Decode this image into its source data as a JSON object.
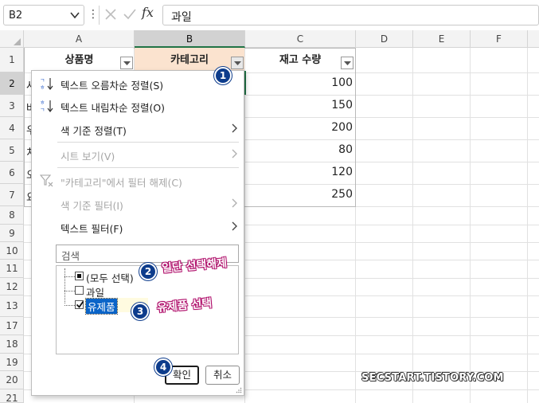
{
  "formula_bar": {
    "name_box": "B2",
    "content": "과일",
    "fx_label": "fx",
    "more_label": "⋮"
  },
  "columns": [
    "A",
    "B",
    "C",
    "D",
    "E",
    "F"
  ],
  "rows": [
    "1",
    "2",
    "3",
    "4",
    "5",
    "6",
    "7",
    "8",
    "9",
    "10",
    "11",
    "12",
    "13",
    "17",
    "18",
    "19",
    "20",
    "21"
  ],
  "table": {
    "headers": [
      "상품명",
      "카테고리",
      "재고 수량"
    ],
    "visible_col_a": [
      "사",
      "바",
      "우",
      "치",
      "오",
      "요"
    ],
    "quantities": [
      "100",
      "150",
      "200",
      "80",
      "120",
      "250"
    ]
  },
  "filter_menu": {
    "sort_asc": "텍스트 오름차순 정렬(S)",
    "sort_desc": "텍스트 내림차순 정렬(O)",
    "sort_by_color": "색 기준 정렬(T)",
    "sheet_view": "시트 보기(V)",
    "clear_filter": "\"카테고리\"에서 필터 해제(C)",
    "filter_by_color": "색 기준 필터(I)",
    "text_filter": "텍스트 필터(F)",
    "search_placeholder": "검색",
    "items": [
      {
        "label": "(모두 선택)",
        "state": "partial"
      },
      {
        "label": "과일",
        "state": "unchecked"
      },
      {
        "label": "유제품",
        "state": "checked"
      }
    ],
    "ok": "확인",
    "cancel": "취소"
  },
  "annotations": {
    "badge1": "1",
    "badge2": "2",
    "badge3": "3",
    "badge4": "4",
    "note2": "일단 선택해제",
    "note3": "유제품 선택"
  },
  "watermark": "SECSTART.TISTORY.COM",
  "colors": {
    "header_fill_category": "#fbe3cf",
    "selection_green": "#217346",
    "badge_blue": "#0d3c8c",
    "annotation_magenta": "#b0116c"
  },
  "icons": [
    "chevron-down-icon",
    "cancel-x-icon",
    "check-icon",
    "fx-icon",
    "sort-asc-icon",
    "sort-desc-icon",
    "filter-clear-icon",
    "chevron-right-icon",
    "filter-dropdown-icon",
    "resize-grip-icon"
  ]
}
